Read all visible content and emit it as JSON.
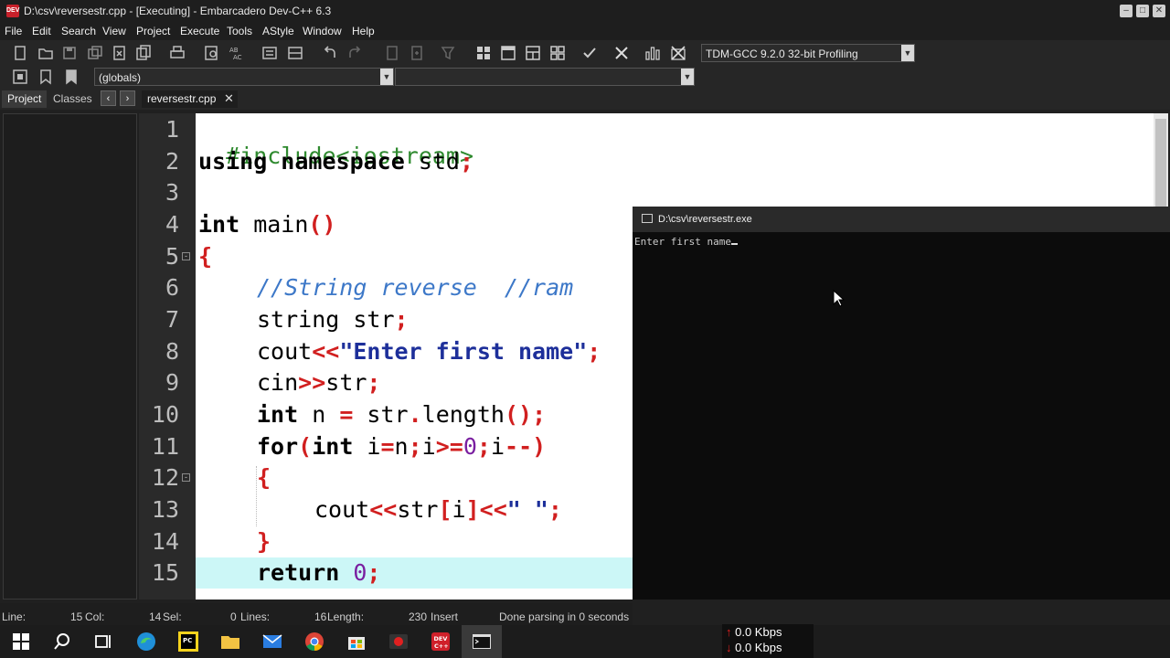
{
  "window": {
    "title": "D:\\csv\\reversestr.cpp - [Executing] - Embarcadero Dev-C++ 6.3",
    "icon_text": "DEV"
  },
  "menu": [
    "File",
    "Edit",
    "Search",
    "View",
    "Project",
    "Execute",
    "Tools",
    "AStyle",
    "Window",
    "Help"
  ],
  "toolbar": {
    "compiler_profile": "TDM-GCC 9.2.0 32-bit Profiling",
    "scope_combo": "(globals)",
    "function_combo": ""
  },
  "panel_tabs": {
    "project": "Project",
    "classes": "Classes"
  },
  "editor": {
    "file_tab": "reversestr.cpp",
    "line_numbers": [
      "1",
      "2",
      "3",
      "4",
      "5",
      "6",
      "7",
      "8",
      "9",
      "10",
      "11",
      "12",
      "13",
      "14",
      "15"
    ],
    "lines": {
      "l1": "#include<iostream>",
      "l2_kw": "using namespace",
      "l2_rest": " std",
      "l2_sym": ";",
      "l4_kw": "int",
      "l4_rest": " main",
      "l4_sym": "()",
      "l5_sym": "{",
      "l6_cmt": "//String reverse  //ram",
      "l7_rest": "string str",
      "l7_sym": ";",
      "l8_a": "cout",
      "l8_b": "<<",
      "l8_c": "\"Enter first name\"",
      "l8_d": ";",
      "l9_a": "cin",
      "l9_b": ">>",
      "l9_c": "str",
      "l9_d": ";",
      "l10_kw": "int",
      "l10_a": " n ",
      "l10_b": "=",
      "l10_c": " str",
      "l10_d": ".",
      "l10_e": "length",
      "l10_f": "();",
      "l11_kw1": "for",
      "l11_a": "(",
      "l11_kw2": "int",
      "l11_b": " i",
      "l11_c": "=",
      "l11_d": "n",
      "l11_e": ";",
      "l11_f": "i",
      "l11_g": ">=",
      "l11_h": "0",
      "l11_i": ";",
      "l11_j": "i",
      "l11_k": "--)",
      "l12_sym": "{",
      "l13_a": "cout",
      "l13_b": "<<",
      "l13_c": "str",
      "l13_d": "[",
      "l13_e": "i",
      "l13_f": "]<<",
      "l13_g": "\" \"",
      "l13_h": ";",
      "l14_sym": "}",
      "l15_kw": "return",
      "l15_num": " 0",
      "l15_sym": ";"
    }
  },
  "console": {
    "title": "D:\\csv\\reversestr.exe",
    "output": "Enter first name"
  },
  "status": {
    "line_label": "Line:",
    "line_value": "15",
    "col_label": "Col:",
    "col_value": "14",
    "sel_label": "Sel:",
    "sel_value": "0",
    "lines_label": "Lines:",
    "lines_value": "16",
    "length_label": "Length:",
    "length_value": "230",
    "mode": "Insert",
    "message": "Done parsing in 0 seconds"
  },
  "network": {
    "upload": "0.0 Kbps",
    "download": "0.0 Kbps"
  },
  "colors": {
    "keyword": "#000000",
    "preprocessor": "#2f8a2f",
    "symbol": "#d11f1f",
    "string": "#1d2f9a",
    "number": "#7a1fa0",
    "comment": "#3d78c8",
    "current_line": "#ccf7f7"
  }
}
